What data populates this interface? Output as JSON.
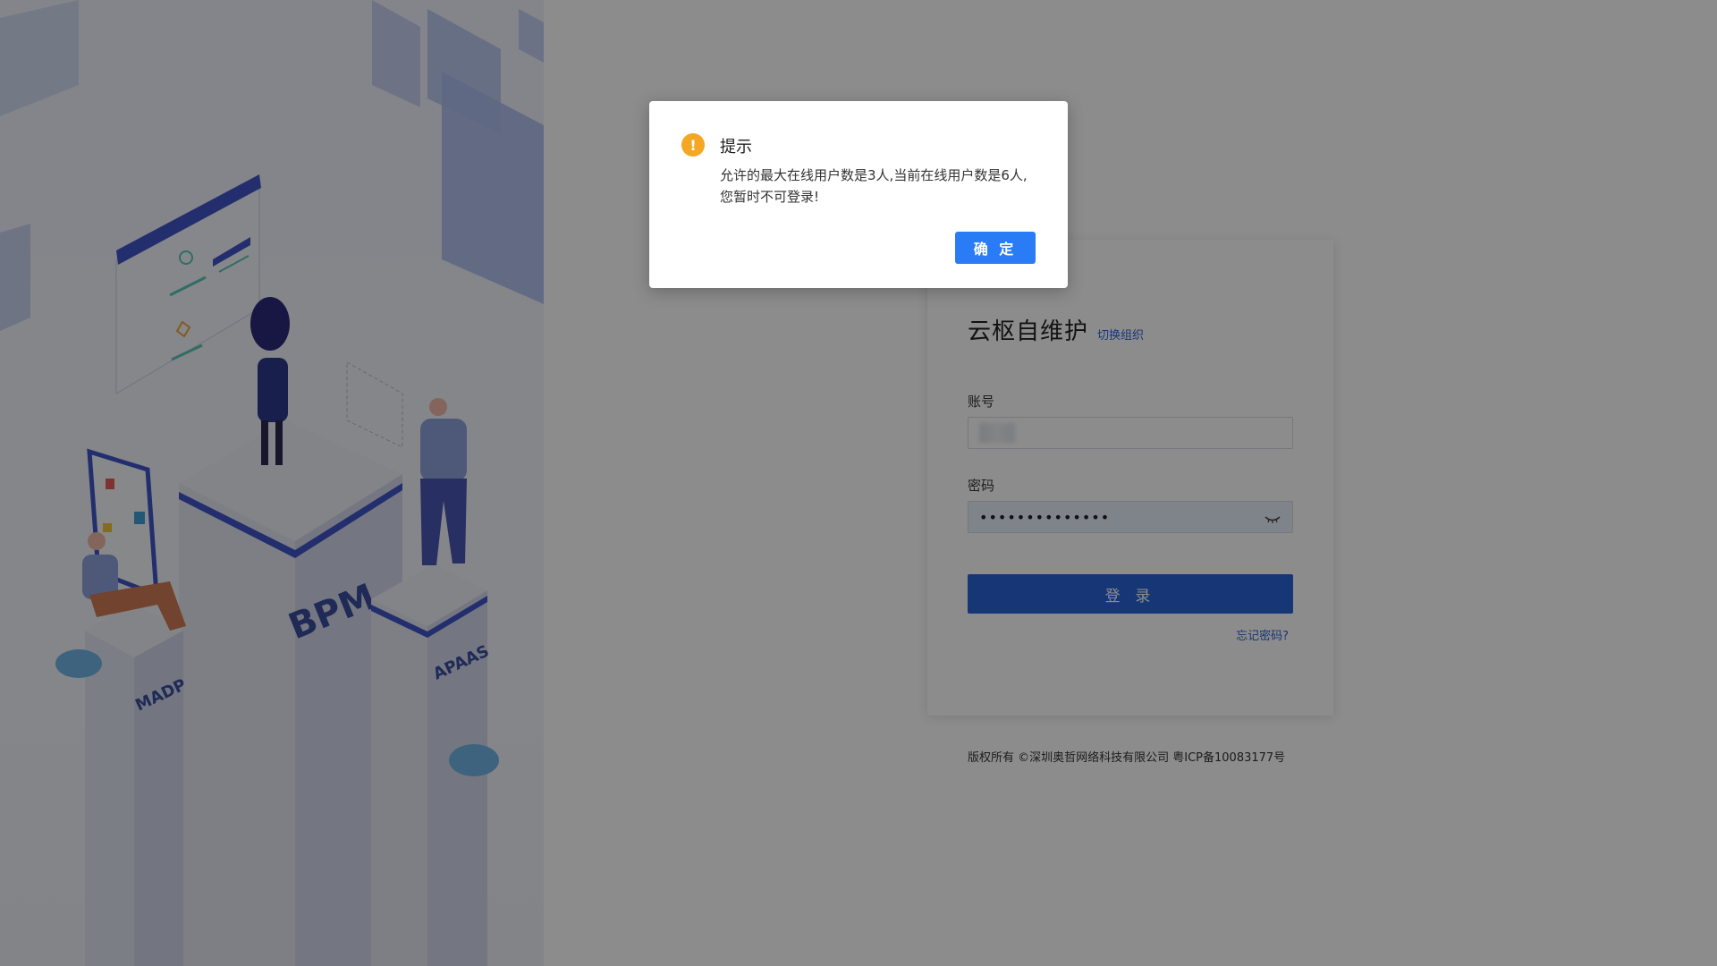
{
  "illustration": {
    "pillar_labels": [
      "MADP",
      "BPM",
      "APAAS"
    ]
  },
  "login": {
    "org_title": "云枢自维护",
    "org_switch": "切换组织",
    "account_label": "账号",
    "password_label": "密码",
    "password_value": "••••••••••••••",
    "login_button": "登 录",
    "forgot_link": "忘记密码?"
  },
  "footer": {
    "copyright": "版权所有 ©深圳奥哲网络科技有限公司 粤ICP备10083177号"
  },
  "modal": {
    "title": "提示",
    "icon": "!",
    "message": "允许的最大在线用户数是3人,当前在线用户数是6人,您暂时不可登录!",
    "ok_button": "确 定"
  },
  "colors": {
    "primary": "#2a63d8",
    "modal_button": "#2a7bf6",
    "warning": "#f5a623"
  }
}
